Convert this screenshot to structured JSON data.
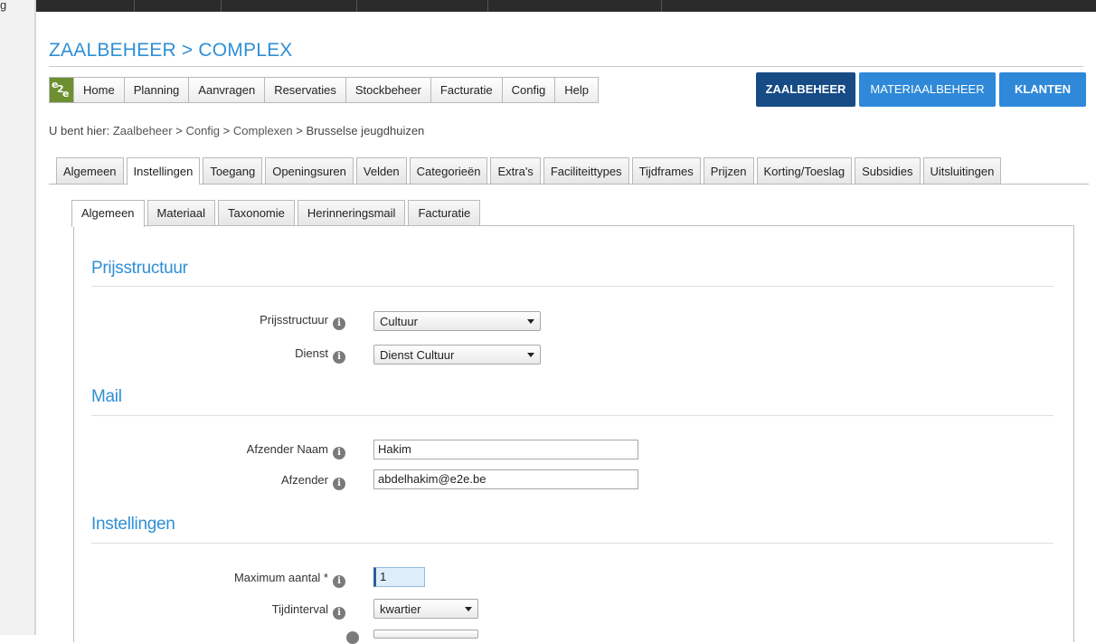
{
  "corner_text": "g",
  "page_title": "ZAALBEHEER > COMPLEX",
  "nav": {
    "items": [
      "Home",
      "Planning",
      "Aanvragen",
      "Reservaties",
      "Stockbeheer",
      "Facturatie",
      "Config",
      "Help"
    ]
  },
  "modules": {
    "zaalbeheer": "ZAALBEHEER",
    "materiaalbeheer": "MATERIAALBEHEER",
    "klanten": "KLANTEN"
  },
  "breadcrumb": {
    "prefix": "U bent hier:",
    "crumbs": [
      "Zaalbeheer",
      "Config",
      "Complexen"
    ],
    "separator": ">",
    "current": "Brusselse jeugdhuizen"
  },
  "tabs": [
    "Algemeen",
    "Instellingen",
    "Toegang",
    "Openingsuren",
    "Velden",
    "Categorieën",
    "Extra's",
    "Faciliteittypes",
    "Tijdframes",
    "Prijzen",
    "Korting/Toeslag",
    "Subsidies",
    "Uitsluitingen"
  ],
  "active_tab": "Instellingen",
  "subtabs": [
    "Algemeen",
    "Materiaal",
    "Taxonomie",
    "Herinneringsmail",
    "Facturatie"
  ],
  "active_subtab": "Algemeen",
  "sections": {
    "prijsstructuur": {
      "title": "Prijsstructuur",
      "prijsstructuur_label": "Prijsstructuur",
      "prijsstructuur_value": "Cultuur",
      "dienst_label": "Dienst",
      "dienst_value": "Dienst Cultuur"
    },
    "mail": {
      "title": "Mail",
      "afzender_naam_label": "Afzender Naam",
      "afzender_naam_value": "Hakim",
      "afzender_label": "Afzender",
      "afzender_value": "abdelhakim@e2e.be"
    },
    "instellingen": {
      "title": "Instellingen",
      "maximum_label": "Maximum aantal *",
      "maximum_value": "1",
      "tijdinterval_label": "Tijdinterval",
      "tijdinterval_value": "kwartier"
    }
  },
  "info_glyph": "i",
  "colors": {
    "accent": "#2f8fd5",
    "module_active": "#164b86",
    "module": "#2f89d8"
  }
}
